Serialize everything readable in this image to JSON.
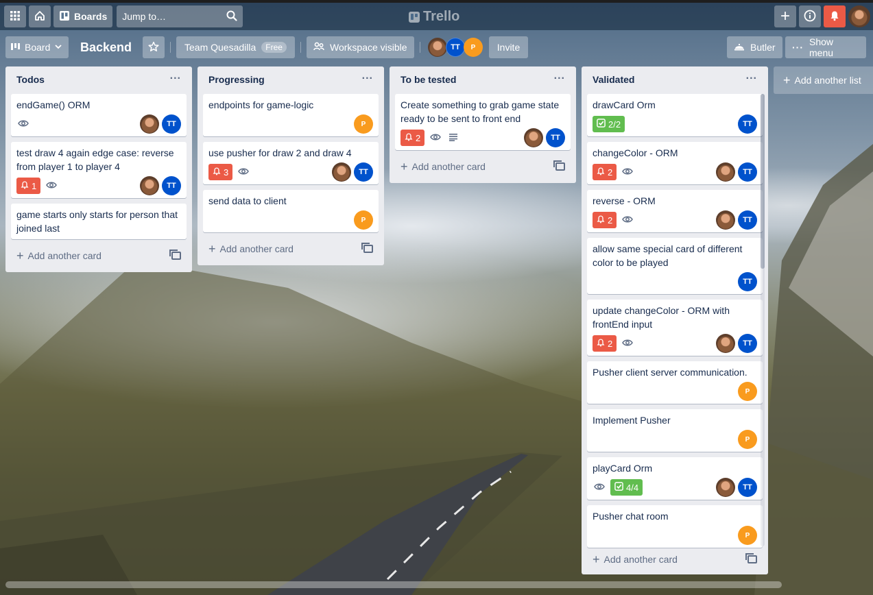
{
  "header": {
    "boards_label": "Boards",
    "search_placeholder": "Jump to…",
    "logo_text": "Trello"
  },
  "boardbar": {
    "view_label": "Board",
    "board_title": "Backend",
    "team_name": "Team Quesadilla",
    "team_badge": "Free",
    "visibility_label": "Workspace visible",
    "invite_label": "Invite",
    "butler_label": "Butler",
    "menu_label": "Show menu",
    "members": [
      {
        "kind": "photo",
        "initials": ""
      },
      {
        "kind": "tt",
        "initials": "TT"
      },
      {
        "kind": "p",
        "initials": "P"
      }
    ]
  },
  "add_card_label": "Add another card",
  "add_list_label": "Add another list",
  "colors": {
    "label_red": "#eb5a46",
    "label_green": "#61bd4f",
    "member_tt": "#0052cc",
    "member_p": "#f99b1e"
  },
  "lists": [
    {
      "title": "Todos",
      "cards": [
        {
          "text": "endGame() ORM",
          "watch": true,
          "members": [
            "photo",
            "tt"
          ]
        },
        {
          "text": "test draw 4 again edge case: reverse from player 1 to player 4",
          "due": "1",
          "watch": true,
          "members": [
            "photo",
            "tt"
          ]
        },
        {
          "text": "game starts only starts for person that joined last"
        }
      ]
    },
    {
      "title": "Progressing",
      "cards": [
        {
          "text": "endpoints for game-logic",
          "members": [
            "p"
          ]
        },
        {
          "text": "use pusher for draw 2 and draw 4",
          "due": "3",
          "watch": true,
          "members": [
            "photo",
            "tt"
          ]
        },
        {
          "text": "send data to client",
          "members": [
            "p"
          ]
        }
      ]
    },
    {
      "title": "To be tested",
      "cards": [
        {
          "text": "Create something to grab game state ready to be sent to front end",
          "due": "2",
          "watch": true,
          "desc": true,
          "members": [
            "photo",
            "tt"
          ]
        }
      ]
    },
    {
      "title": "Validated",
      "cards": [
        {
          "text": "drawCard Orm",
          "check": "2/2",
          "members": [
            "tt"
          ]
        },
        {
          "text": "changeColor - ORM",
          "due": "2",
          "watch": true,
          "members": [
            "photo",
            "tt"
          ]
        },
        {
          "text": "reverse - ORM",
          "due": "2",
          "watch": true,
          "members": [
            "photo",
            "tt"
          ]
        },
        {
          "text": "allow same special card of different color to be played",
          "members": [
            "tt"
          ]
        },
        {
          "text": "update changeColor - ORM with frontEnd input",
          "due": "2",
          "watch": true,
          "members": [
            "photo",
            "tt"
          ]
        },
        {
          "text": "Pusher client server communication.",
          "members": [
            "p"
          ]
        },
        {
          "text": "Implement Pusher",
          "members": [
            "p"
          ]
        },
        {
          "text": "playCard Orm",
          "watch": true,
          "check": "4/4",
          "members": [
            "photo",
            "tt"
          ]
        },
        {
          "text": "Pusher chat room",
          "members": [
            "p"
          ]
        }
      ]
    }
  ]
}
